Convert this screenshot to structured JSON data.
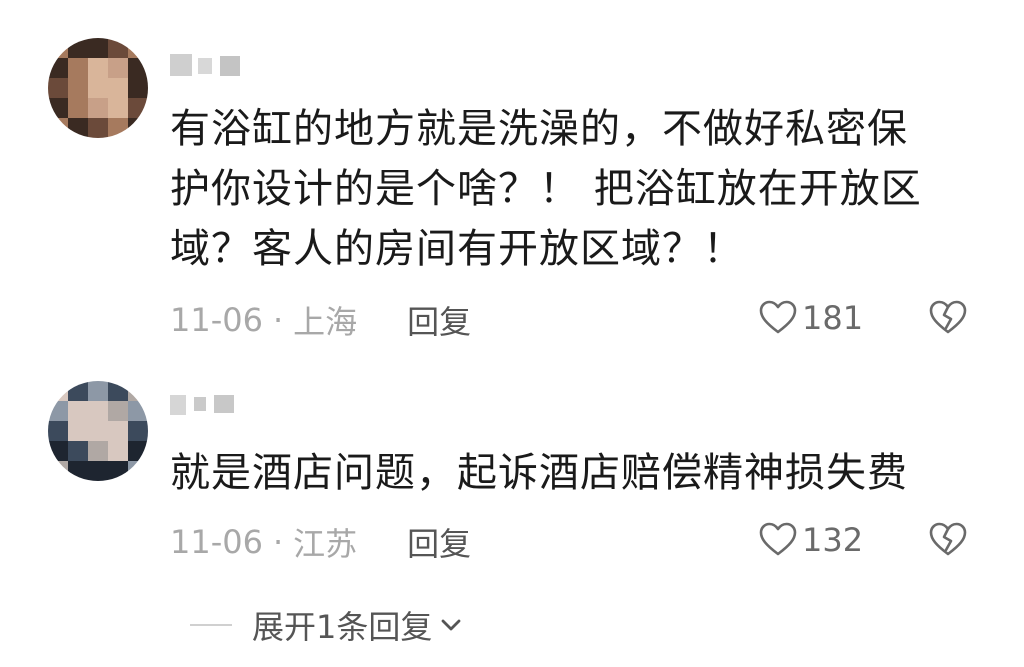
{
  "comments": [
    {
      "text_lines": [
        "有浴缸的地方就是洗澡的，不做好私密保",
        "护你设计的是个啥？！ 把浴缸放在开放区",
        "域？客人的房间有开放区域？！"
      ],
      "date": "11-06",
      "separator": "·",
      "location": "上海",
      "reply_label": "回复",
      "likes": "181",
      "avatar_colors": [
        "#6b4a3a",
        "#a67a5e",
        "#d9b59a",
        "#3a2a22",
        "#c8a088"
      ]
    },
    {
      "text_lines": [
        "就是酒店问题，起诉酒店赔偿精神损失费"
      ],
      "date": "11-06",
      "separator": "·",
      "location": "江苏",
      "reply_label": "回复",
      "likes": "132",
      "avatar_colors": [
        "#3c4a5c",
        "#8d98a6",
        "#d8c8c0",
        "#1e2530",
        "#b0a8a4"
      ]
    }
  ],
  "expand_replies_label": "展开1条回复",
  "icons": {
    "like": "heart-outline-icon",
    "dislike": "broken-heart-icon",
    "expand": "chevron-down-icon"
  },
  "colors": {
    "text": "#1a1a1a",
    "meta": "#a8a8a8",
    "reply": "#555555",
    "icon": "#6a6a6a"
  }
}
